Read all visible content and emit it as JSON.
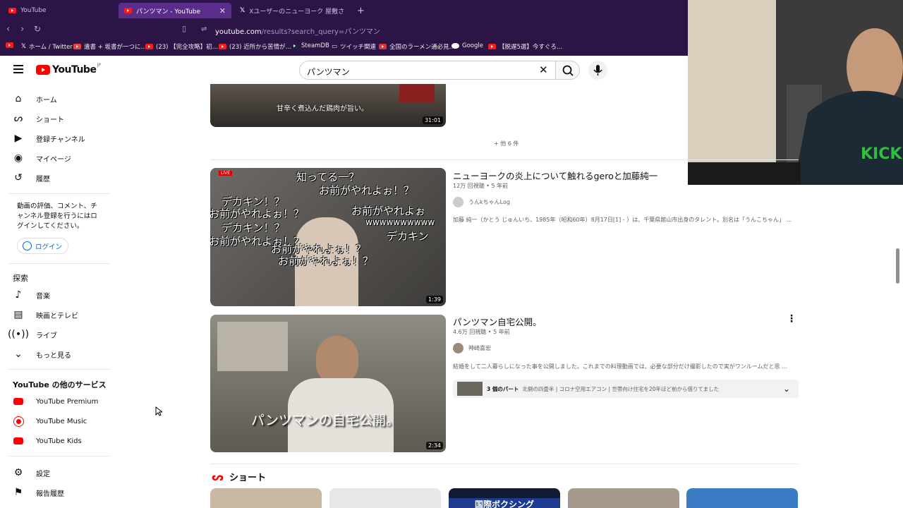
{
  "browser": {
    "tabs": [
      {
        "label": "YouTube",
        "active": false
      },
      {
        "label": "パンツマン - YouTube",
        "active": true
      },
      {
        "label": "Xユーザーのニューヨーク 屋敷さん: 「パンツ…",
        "active": false
      }
    ],
    "url_host": "youtube.com",
    "url_path": "/results?search_query=パンツマン",
    "bookmarks": [
      "ホーム / Twitter",
      "遺書 + 坂書が一つに…",
      "(23) 【完全攻略】初…",
      "(23) 近所から苦情が…",
      "SteamDB",
      "ツイッチ関連",
      "全国のラーメン通必見…",
      "Google",
      "【脱遅5選】今すぐろ…"
    ]
  },
  "header": {
    "logo_text": "YouTube",
    "logo_region": "JP",
    "search_value": "パンツマン"
  },
  "sidebar": {
    "main": [
      {
        "label": "ホーム",
        "icon": "home-icon"
      },
      {
        "label": "ショート",
        "icon": "shorts-icon"
      },
      {
        "label": "登録チャンネル",
        "icon": "subscriptions-icon"
      },
      {
        "label": "マイページ",
        "icon": "you-icon"
      },
      {
        "label": "履歴",
        "icon": "history-icon"
      }
    ],
    "signin_prompt": "動画の評価、コメント、チャンネル登録を行うにはログインしてください。",
    "signin_button": "ログイン",
    "explore_title": "探索",
    "explore": [
      {
        "label": "音楽",
        "icon": "music-icon"
      },
      {
        "label": "映画とテレビ",
        "icon": "movies-icon"
      },
      {
        "label": "ライブ",
        "icon": "live-icon"
      },
      {
        "label": "もっと見る",
        "icon": "chevron-down-icon"
      }
    ],
    "more_title": "YouTube の他のサービス",
    "services": [
      "YouTube Premium",
      "YouTube Music",
      "YouTube Kids"
    ],
    "settings": [
      {
        "label": "設定",
        "icon": "gear-icon"
      },
      {
        "label": "報告履歴",
        "icon": "flag-icon"
      }
    ]
  },
  "results": {
    "top_duration": "31:01",
    "top_caption": "甘辛く煮込んだ鶏肉が旨い。",
    "more_label": "+ 他 6 件",
    "videos": [
      {
        "title": "ニューヨークの炎上について触れるgeroと加藤純一",
        "meta": "12万 回視聴 • 5 年前",
        "channel": "うんkちゃんLog",
        "desc": "加藤 純一（かとう じゅんいち、1985年（昭和60年）8月17日[1] - ）は、千葉県館山市出身のタレント。別名は「うんこちゃん」 ...",
        "duration": "1:39",
        "live_badge": "LIVE",
        "overlay_lines": [
          "知ってる一？",
          "お前がやれよぉ！？",
          "デカキン！？",
          "お前がやれよぉ！？",
          "お前がやれよぉ",
          "デカキン！？",
          "wwwwwwwwww",
          "デカキン",
          "お前がやれよぉ！？",
          "お前がやれよぉ！？",
          "お前がやれよぉ！？"
        ]
      },
      {
        "title": "パンツマン自宅公開。",
        "meta": "4.6万 回視聴 • 5 年前",
        "channel": "神崎喜宏",
        "desc": "結婚をして二人暮らしになった事を公開しました。これまでの料理動画では、必要な部分だけ撮影したので実がワンルームだと思 ...",
        "duration": "2:34",
        "overlay": "パンツマンの自宅公開。",
        "chapters_count": "3 個のパート",
        "chapters_text": "北側の四畳半 | コロナ空用エアコン | 世帯向け住宅を20年ほど前から借りてました"
      }
    ],
    "shorts_title": "ショート",
    "short_overlay": "国際ボクシング"
  },
  "webcam_shirt": "KICK"
}
